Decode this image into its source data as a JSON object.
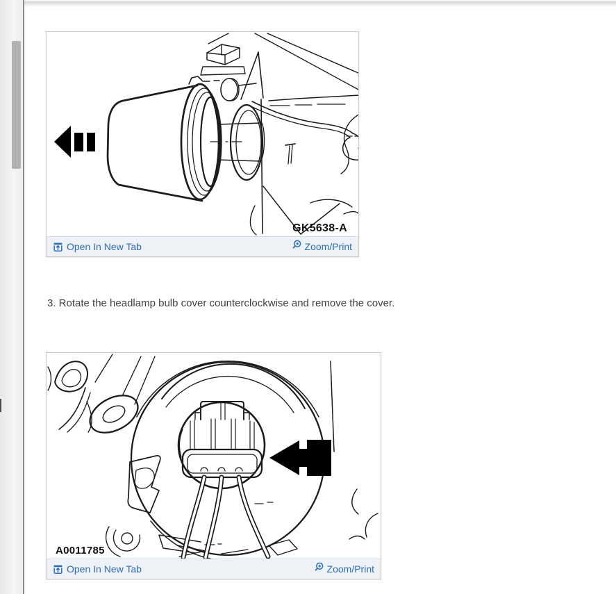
{
  "step": {
    "text": "3. Rotate the headlamp bulb cover counterclockwise and remove the cover."
  },
  "figures": [
    {
      "caption": "GK5638-A",
      "open_in_new_tab": "Open In New Tab",
      "zoom_print": "Zoom/Print",
      "description": "Headlamp bulb cover being pulled off, arrow pointing left"
    },
    {
      "caption": "A0011785",
      "open_in_new_tab": "Open In New Tab",
      "zoom_print": "Zoom/Print",
      "description": "Headlamp bulb electrical connector with three wires, arrow pointing left"
    }
  ],
  "icons": {
    "open": "open-in-new-tab",
    "zoom": "magnifier-plus"
  },
  "colors": {
    "link": "#2d6eb4",
    "footer_bg": "#eef1f5",
    "figure_border": "#cbcbcb",
    "text": "#3f3f3f",
    "scroll_thumb": "#b2b2b2",
    "rail_border": "#8d8d8d"
  }
}
